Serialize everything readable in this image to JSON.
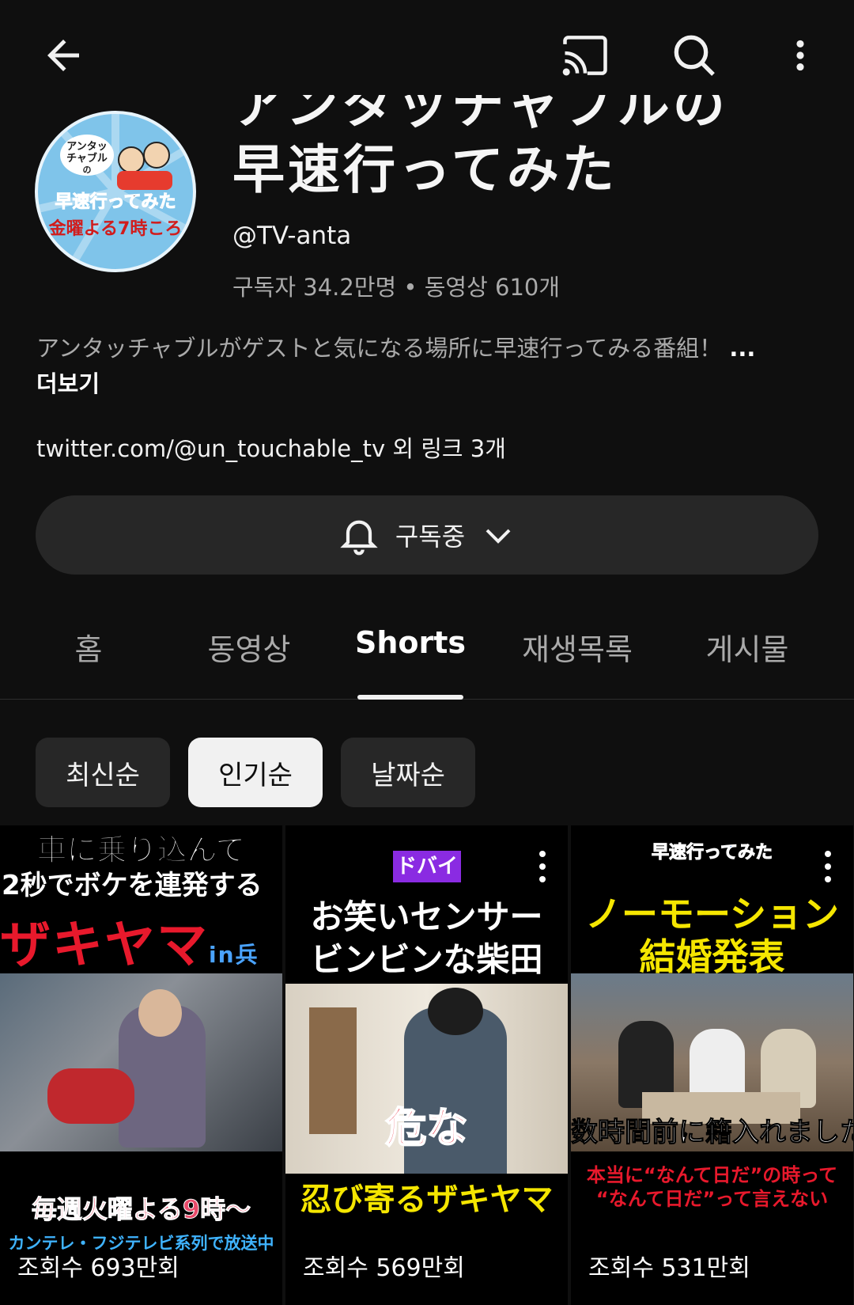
{
  "header": {
    "back_icon": "arrow-left-icon",
    "cast_icon": "cast-icon",
    "search_icon": "search-icon",
    "more_icon": "more-vert-icon"
  },
  "channel": {
    "avatar_lines": [
      "アンタッ",
      "チャブル",
      "の",
      "早速行ってみた",
      "金曜よる7時ころ"
    ],
    "title_line1": "アンタッチャブルの",
    "title_line2": "早速行ってみた",
    "handle": "@TV-anta",
    "stats": "구독자 34.2만명 • 동영상 610개",
    "description": "アンタッチャブルがゲストと気になる場所に早速行ってみる番組！",
    "more_label": "...더보기",
    "links": "twitter.com/@un_touchable_tv 외 링크 3개"
  },
  "subscribe": {
    "label": "구독중",
    "bell_icon": "bell-icon",
    "chevron_icon": "chevron-down-icon"
  },
  "tabs": [
    {
      "label": "홈",
      "active": false
    },
    {
      "label": "동영상",
      "active": false
    },
    {
      "label": "Shorts",
      "active": true
    },
    {
      "label": "재생목록",
      "active": false
    },
    {
      "label": "게시물",
      "active": false
    }
  ],
  "sort_chips": [
    {
      "label": "최신순",
      "selected": false
    },
    {
      "label": "인기순",
      "selected": true
    },
    {
      "label": "날짜순",
      "selected": false
    }
  ],
  "shorts": [
    {
      "top_caption_1": "車に乗り込んで",
      "top_caption_2": "2秒でボケを連発する",
      "top_caption_3": "ザキヤマ",
      "top_caption_3b": "in兵庫",
      "overlay_1": "毎週火曜よる9時〜",
      "overlay_2": "カンテレ・フジテレビ系列で放送中",
      "views": "조회수 693만회"
    },
    {
      "badge": "ドバイ",
      "top_caption_1": "お笑いセンサー",
      "top_caption_2": "ビンビンな柴田",
      "overlay_1": "危な",
      "overlay_2": "忍び寄るザキヤマ",
      "views": "조회수 569만회"
    },
    {
      "logo": "早速行ってみた",
      "top_caption_1": "ノーモーション",
      "top_caption_2": "結婚発表",
      "overlay_1": "数時間前に籍入れました。",
      "overlay_2": "本当に“なんて日だ”の時って",
      "overlay_3": "“なんて日だ”って言えない",
      "views": "조회수 531만회"
    }
  ],
  "colors": {
    "background": "#0f0f0f",
    "chip_bg": "#272727",
    "chip_selected_bg": "#f1f1f1",
    "caption_red": "#e8192c",
    "caption_yellow": "#f5e600"
  }
}
